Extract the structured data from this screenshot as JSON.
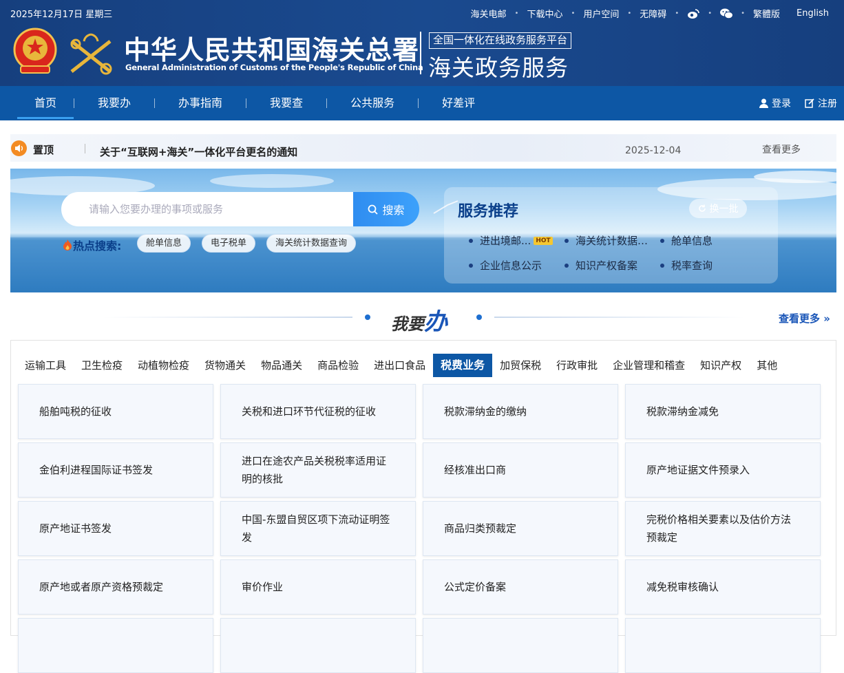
{
  "header": {
    "date": "2025年12月17日 星期三",
    "top_links": [
      "海关电邮",
      "下载中心",
      "用户空间",
      "无障碍"
    ],
    "traditional": "繁體版",
    "english": "English",
    "logo_cn": "中华人民共和国海关总署",
    "logo_en": "General Administration of Customs of the People's Republic of China",
    "platform_sub": "全国一体化在线政务服务平台",
    "platform_main": "海关政务服务"
  },
  "nav": {
    "items": [
      "首页",
      "我要办",
      "办事指南",
      "我要查",
      "公共服务",
      "好差评"
    ],
    "login": "登录",
    "register": "注册"
  },
  "notice": {
    "pin_label": "置顶",
    "title": "关于“互联网+海关”一体化平台更名的通知",
    "date": "2025-12-04",
    "more": "查看更多"
  },
  "search": {
    "placeholder": "请输入您要办理的事项或服务",
    "button": "搜索",
    "hot_label": "热点搜索:",
    "hot_tags": [
      "舱单信息",
      "电子税单",
      "海关统计数据查询"
    ]
  },
  "recommend": {
    "title": "服务推荐",
    "refresh": "换一批",
    "items": [
      "进出境邮...",
      "海关统计数据…",
      "舱单信息",
      "企业信息公示",
      "知识产权备案",
      "税率查询"
    ],
    "hot_badge": "HOT"
  },
  "section": {
    "title_small": "我要",
    "title_big": "办",
    "more": "查看更多"
  },
  "categories": [
    "运输工具",
    "卫生检疫",
    "动植物检疫",
    "货物通关",
    "物品通关",
    "商品检验",
    "进出口食品",
    "税费业务",
    "加贸保税",
    "行政审批",
    "企业管理和稽查",
    "知识产权",
    "其他"
  ],
  "active_category": "税费业务",
  "services": [
    "船舶吨税的征收",
    "关税和进口环节代征税的征收",
    "税款滞纳金的缴纳",
    "税款滞纳金减免",
    "金伯利进程国际证书签发",
    "进口在途农产品关税税率适用证明的核批",
    "经核准出口商",
    "原产地证据文件预录入",
    "原产地证书签发",
    "中国-东盟自贸区项下流动证明签发",
    "商品归类预裁定",
    "完税价格相关要素以及估价方法预裁定",
    "原产地或者原产资格预裁定",
    "审价作业",
    "公式定价备案",
    "减免税审核确认"
  ],
  "colors": {
    "header": "#163f7e",
    "nav": "#0d57a5",
    "accent": "#1a56b8",
    "notice_icon": "#f38b23"
  }
}
